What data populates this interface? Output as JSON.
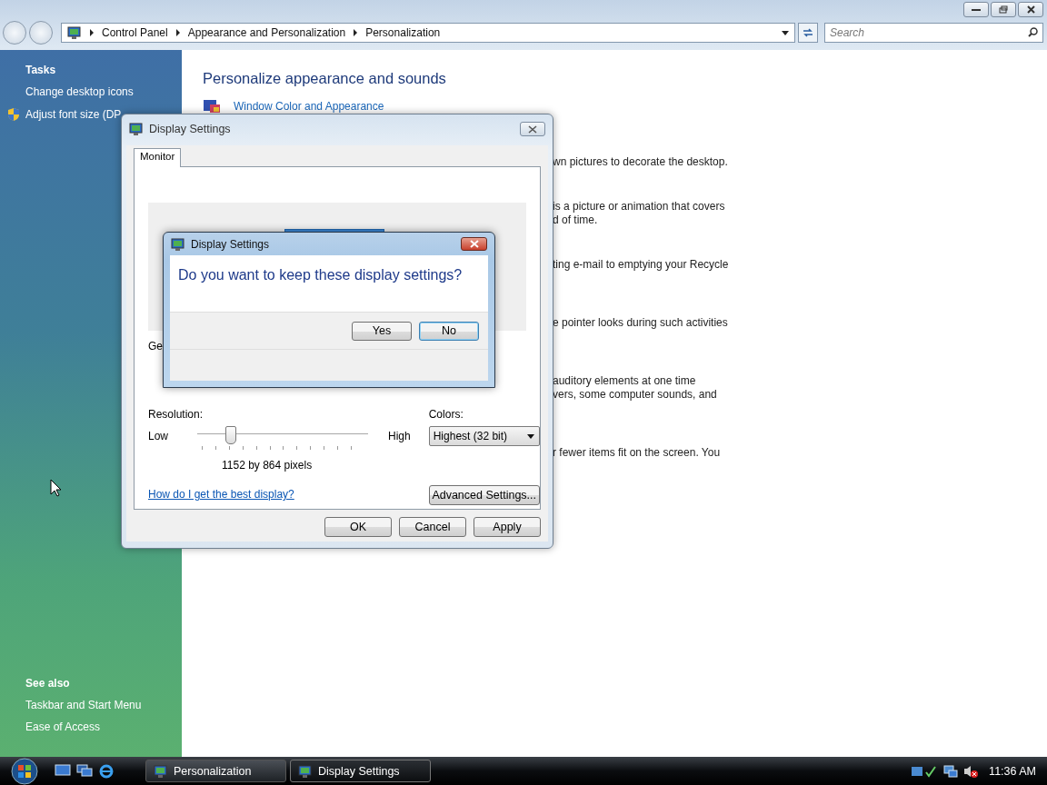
{
  "explorer": {
    "breadcrumb": [
      "Control Panel",
      "Appearance and Personalization",
      "Personalization"
    ],
    "search": {
      "placeholder": "Search"
    }
  },
  "sidebar": {
    "tasks_heading": "Tasks",
    "tasks": [
      {
        "label": "Change desktop icons",
        "kind": "link"
      },
      {
        "label": "Adjust font size (DP",
        "kind": "shield"
      }
    ],
    "see_also_heading": "See also",
    "see_also": [
      "Taskbar and Start Menu",
      "Ease of Access"
    ]
  },
  "main": {
    "heading": "Personalize appearance and sounds",
    "link": "Window Color and Appearance",
    "fragments": [
      [
        "wn pictures to decorate the desktop."
      ],
      [
        "is a picture or animation that covers",
        "d of time."
      ],
      [
        "ting e-mail to emptying your Recycle"
      ],
      [
        "e pointer looks during such activities"
      ],
      [
        "auditory elements at one time",
        "vers, some computer sounds, and"
      ],
      [
        "r fewer items fit on the screen. You"
      ]
    ]
  },
  "display_settings": {
    "title": "Display Settings",
    "tabs": [
      {
        "label": "Monitor",
        "selected": true
      }
    ],
    "fragment": "Ge",
    "resolution_label": "Resolution:",
    "low": "Low",
    "high": "High",
    "resolution": {
      "level": 0.19
    },
    "pixels": "1152 by 864 pixels",
    "colors_label": "Colors:",
    "colors_value": "Highest (32 bit)",
    "help_link": "How do I get the best display?",
    "advanced_button": "Advanced Settings...",
    "buttons": [
      "OK",
      "Cancel",
      "Apply"
    ]
  },
  "confirm": {
    "title": "Display Settings",
    "question": "Do you want to keep these display settings?",
    "buttons": [
      {
        "label": "Yes",
        "default": false
      },
      {
        "label": "No",
        "default": true
      }
    ]
  },
  "taskbar": {
    "tasks": [
      {
        "label": "Personalization",
        "selected": false
      },
      {
        "label": "Display Settings",
        "selected": true
      }
    ],
    "clock": "11:36 AM"
  }
}
